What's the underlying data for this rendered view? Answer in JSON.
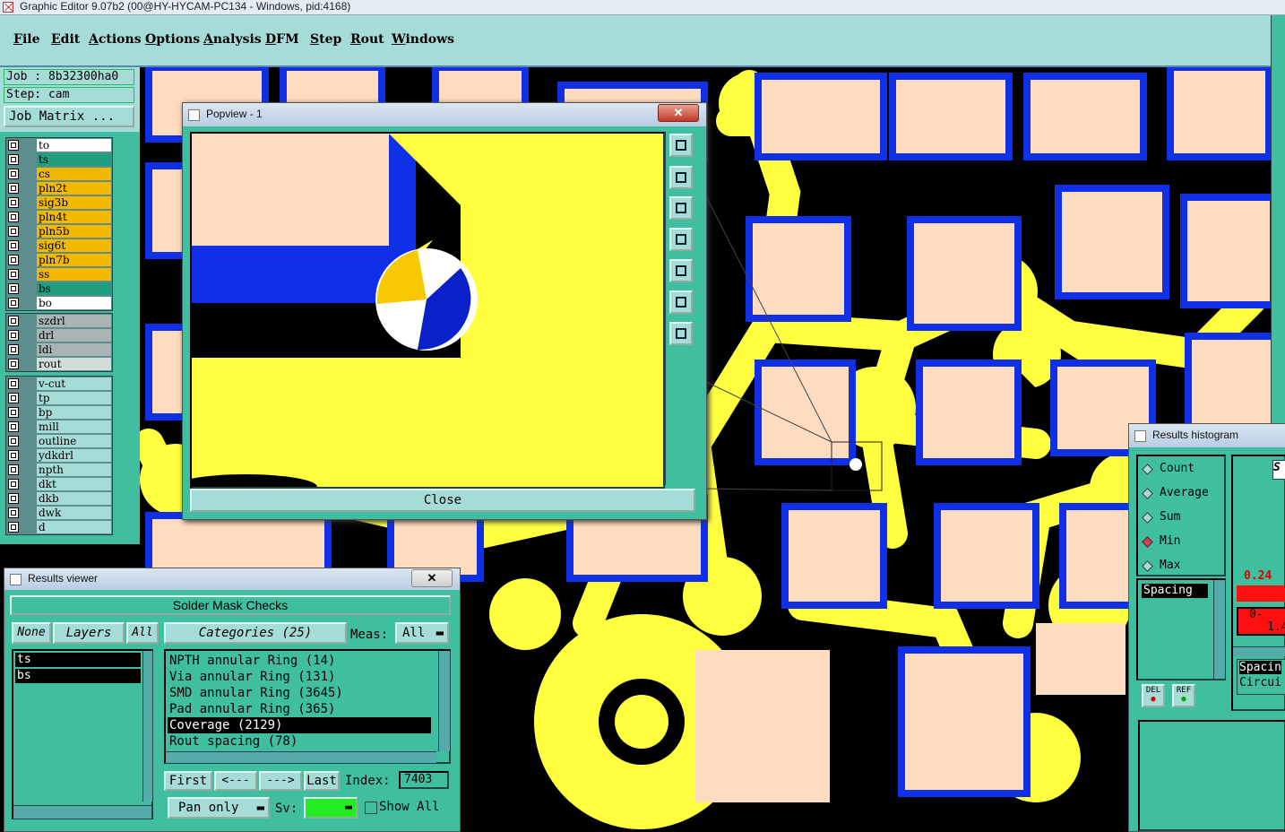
{
  "window": {
    "title": "Graphic Editor 9.07b2 (00@HY-HYCAM-PC134 - Windows, pid:4168)"
  },
  "menu": [
    "File",
    "Edit",
    "Actions",
    "Options",
    "Analysis",
    "DFM",
    "Step",
    "Rout",
    "Windows"
  ],
  "job": {
    "job_label": "Job : 8b32300ha0",
    "step_label": "Step: cam",
    "matrix_button": "Job Matrix ..."
  },
  "layers": {
    "board": [
      {
        "name": "to",
        "color": "#ffffff"
      },
      {
        "name": "ts",
        "color": "#1f9f7f"
      },
      {
        "name": "cs",
        "color": "#f5b800"
      },
      {
        "name": "pln2t",
        "color": "#f5b800"
      },
      {
        "name": "sig3b",
        "color": "#f5b800"
      },
      {
        "name": "pln4t",
        "color": "#f5b800"
      },
      {
        "name": "pln5b",
        "color": "#f5b800"
      },
      {
        "name": "sig6t",
        "color": "#f5b800"
      },
      {
        "name": "pln7b",
        "color": "#f5b800"
      },
      {
        "name": "ss",
        "color": "#f5b800"
      },
      {
        "name": "bs",
        "color": "#1f9f7f"
      },
      {
        "name": "bo",
        "color": "#ffffff"
      }
    ],
    "drill": [
      {
        "name": "szdrl",
        "color": "#aab4b4"
      },
      {
        "name": "drl",
        "color": "#aab4b4"
      },
      {
        "name": "ldi",
        "color": "#aab4b4"
      },
      {
        "name": "rout",
        "color": "#d4dcdc"
      }
    ],
    "misc": [
      {
        "name": "v-cut",
        "color": "#a5dcd8"
      },
      {
        "name": "tp",
        "color": "#a5dcd8"
      },
      {
        "name": "bp",
        "color": "#a5dcd8"
      },
      {
        "name": "mill",
        "color": "#a5dcd8"
      },
      {
        "name": "outline",
        "color": "#a5dcd8"
      },
      {
        "name": "ydkdrl",
        "color": "#a5dcd8"
      },
      {
        "name": "npth",
        "color": "#a5dcd8"
      },
      {
        "name": "dkt",
        "color": "#a5dcd8"
      },
      {
        "name": "dkb",
        "color": "#a5dcd8"
      },
      {
        "name": "dwk",
        "color": "#a5dcd8"
      },
      {
        "name": "d",
        "color": "#a5dcd8"
      }
    ]
  },
  "popview": {
    "title": "Popview - 1",
    "close_label": "Close"
  },
  "results_viewer": {
    "title": "Results viewer",
    "header": "Solder Mask Checks",
    "none_label": "None",
    "layers_label": "Layers",
    "all_label": "All",
    "layer_list": [
      "ts",
      "bs"
    ],
    "categories_label": "Categories (25)",
    "meas_label": "Meas:",
    "meas_value": "All",
    "categories": [
      "NPTH annular Ring (14)",
      "Via annular Ring (131)",
      "SMD annular Ring (3645)",
      "Pad annular Ring (365)",
      "Coverage (2129)",
      "Rout spacing (78)"
    ],
    "selected_category": 4,
    "nav": {
      "first": "First",
      "prev": "<---",
      "next": "--->",
      "last": "Last",
      "index_label": "Index:",
      "index_value": "7403"
    },
    "pan_label": "Pan only",
    "sv_label": "Sv:",
    "show_all_label": "Show All"
  },
  "histogram": {
    "title": "Results histogram",
    "stats": [
      "Count",
      "Average",
      "Sum",
      "Min",
      "Max"
    ],
    "selected_stat": 3,
    "measure_list": [
      "Spacing"
    ],
    "del_label": "DEL",
    "ref_label": "REF",
    "value_label": "0.24",
    "range_label_1": "0-",
    "range_label_2": "1.4",
    "bottom_list": [
      "Spacin",
      "Circui"
    ],
    "side_letter": "S"
  },
  "colors": {
    "panel": "#40bfa0",
    "button": "#a5dcd8",
    "pad": "#ffdcc0",
    "trace": "#ffff40",
    "mask": "#1030e8",
    "selected_stat": "#d04050",
    "histo_bar": "#ff1010"
  }
}
